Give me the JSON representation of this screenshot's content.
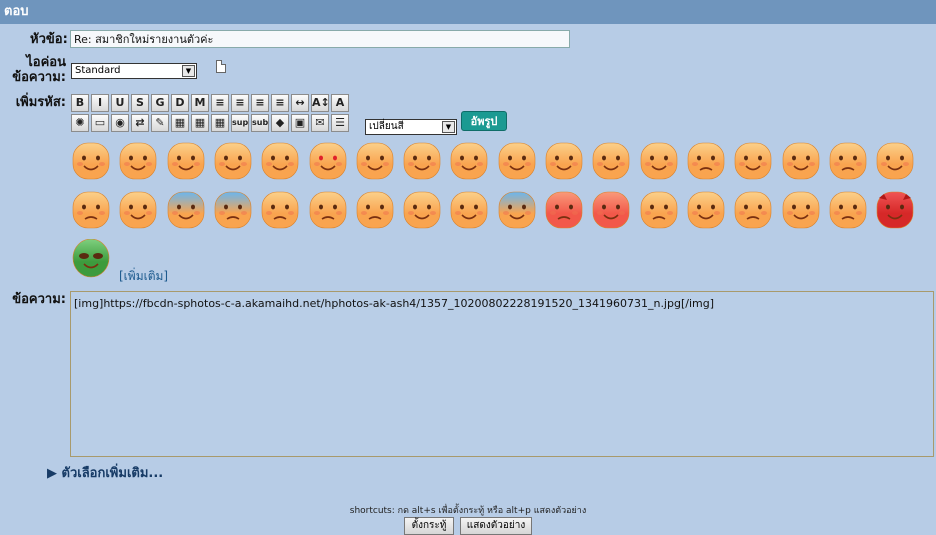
{
  "header": {
    "title": "ตอบ"
  },
  "form": {
    "subject_label": "หัวข้อ:",
    "subject_value": "Re: สมาชิกใหม่รายงานตัวค่ะ",
    "icon_label_line1": "ไอค่อน",
    "icon_label_line2": "ข้อความ:",
    "icon_select_value": "Standard",
    "code_label": "เพิ่มรหัส:",
    "color_select_value": "เปลี่ยนสี",
    "upload_label": "อัพรูป",
    "more_smileys_label": "[เพิ่มเติม]",
    "message_label": "ข้อความ:",
    "message_value": "[img]https://fbcdn-sphotos-c-a.akamaihd.net/hphotos-ak-ash4/1357_10200802228191520_1341960731_n.jpg[/img]",
    "more_options_label": "ตัวเลือกเพิ่มเติม...",
    "shortcuts_text": "shortcuts: กด alt+s เพื่อตั้งกระทู้ หรือ alt+p แสดงตัวอย่าง",
    "submit_label": "ตั้งกระทู้",
    "preview_label": "แสดงตัวอย่าง"
  },
  "toolbar_row1": [
    "B",
    "I",
    "U",
    "S",
    "G",
    "D",
    "M",
    "≡",
    "≡",
    "≡",
    "≡",
    "↔",
    "A↕",
    "A"
  ],
  "toolbar_row2": [
    "✺",
    "▭",
    "◉",
    "⇄",
    "✎",
    "▦",
    "▦",
    "▦",
    "sup",
    "sub",
    "◆",
    "▣",
    "✉",
    "☰"
  ],
  "colors": {
    "header_bg": "#6f95bd",
    "page_bg": "#b7cce6",
    "upload_bg": "#1b9a92",
    "link": "#1c5a8e"
  },
  "emoji_names": [
    "grin-face-icon",
    "smile-face-icon",
    "laugh-face-icon",
    "squint-smile-icon",
    "wink-tongue-icon",
    "heart-eyes-icon",
    "kiss-heart-icon",
    "kiss-face-icon",
    "wide-eyed-icon",
    "blush-smile-icon",
    "big-grin-icon",
    "squint-tongue-icon",
    "tongue-out-icon",
    "sad-smile-icon",
    "smirk-face-icon",
    "sweat-smile-icon",
    "pensive-face-icon",
    "flushed-face-icon",
    "dizzy-face-icon",
    "sweat-face-icon",
    "cold-sweat-icon",
    "fearful-face-icon",
    "persevere-face-icon",
    "cry-face-icon",
    "loud-cry-icon",
    "tears-joy-icon",
    "dead-face-icon",
    "scream-face-icon",
    "frown-face-icon",
    "angry-face-icon",
    "sleepy-face-icon",
    "mask-face-icon",
    "neutral-face-icon",
    "relieved-face-icon",
    "dizzy-smile-icon",
    "devil-face-icon",
    "alien-face-icon"
  ]
}
